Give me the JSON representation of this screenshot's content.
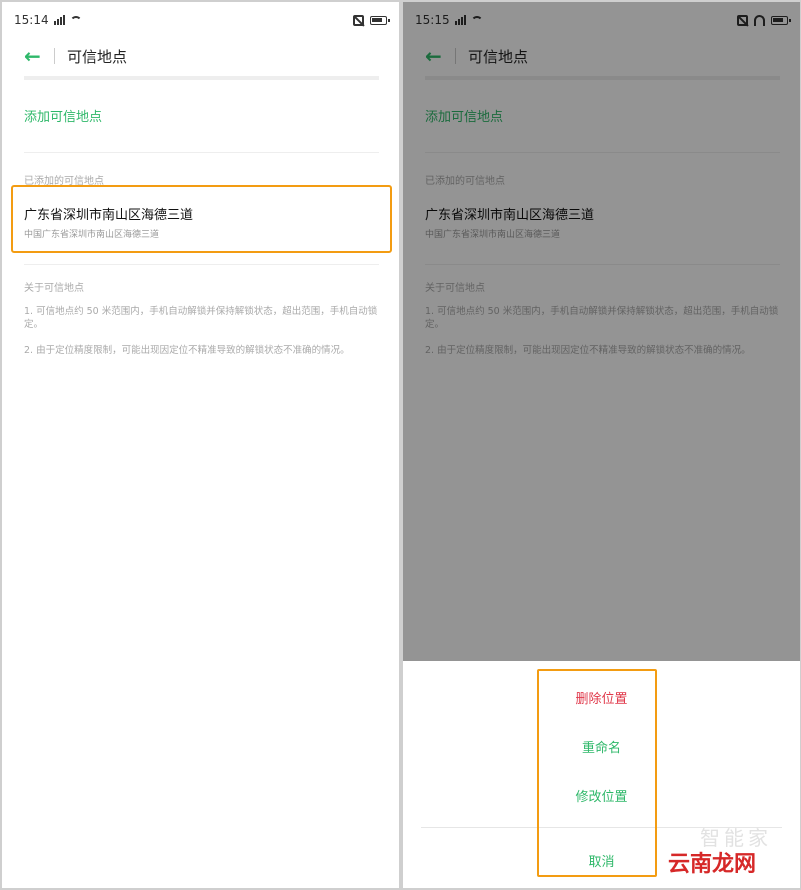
{
  "left": {
    "status": {
      "time": "15:14"
    },
    "header": {
      "back_icon": "←",
      "title": "可信地点"
    },
    "add_link": "添加可信地点",
    "section_label": "已添加的可信地点",
    "place": {
      "name": "广东省深圳市南山区海德三道",
      "address": "中国广东省深圳市南山区海德三道"
    },
    "about": {
      "title": "关于可信地点",
      "point1": "1. 可信地点约 50 米范围内，手机自动解锁并保持解锁状态，超出范围，手机自动锁定。",
      "point2": "2. 由于定位精度限制，可能出现因定位不精准导致的解锁状态不准确的情况。"
    }
  },
  "right": {
    "status": {
      "time": "15:15"
    },
    "header": {
      "back_icon": "←",
      "title": "可信地点"
    },
    "add_link": "添加可信地点",
    "section_label": "已添加的可信地点",
    "place": {
      "name": "广东省深圳市南山区海德三道",
      "address": "中国广东省深圳市南山区海德三道"
    },
    "about": {
      "title": "关于可信地点",
      "point1": "1. 可信地点约 50 米范围内，手机自动解锁并保持解锁状态，超出范围，手机自动锁定。",
      "point2": "2. 由于定位精度限制，可能出现因定位不精准导致的解锁状态不准确的情况。"
    },
    "action_sheet": {
      "delete_label": "删除位置",
      "rename_label": "重命名",
      "modify_label": "修改位置",
      "cancel_label": "取消"
    }
  },
  "watermark": {
    "top": "智能家",
    "bottom": "云南龙网"
  },
  "colors": {
    "accent": "#2fb86a",
    "danger": "#e0384a",
    "highlight": "#f39c12"
  }
}
